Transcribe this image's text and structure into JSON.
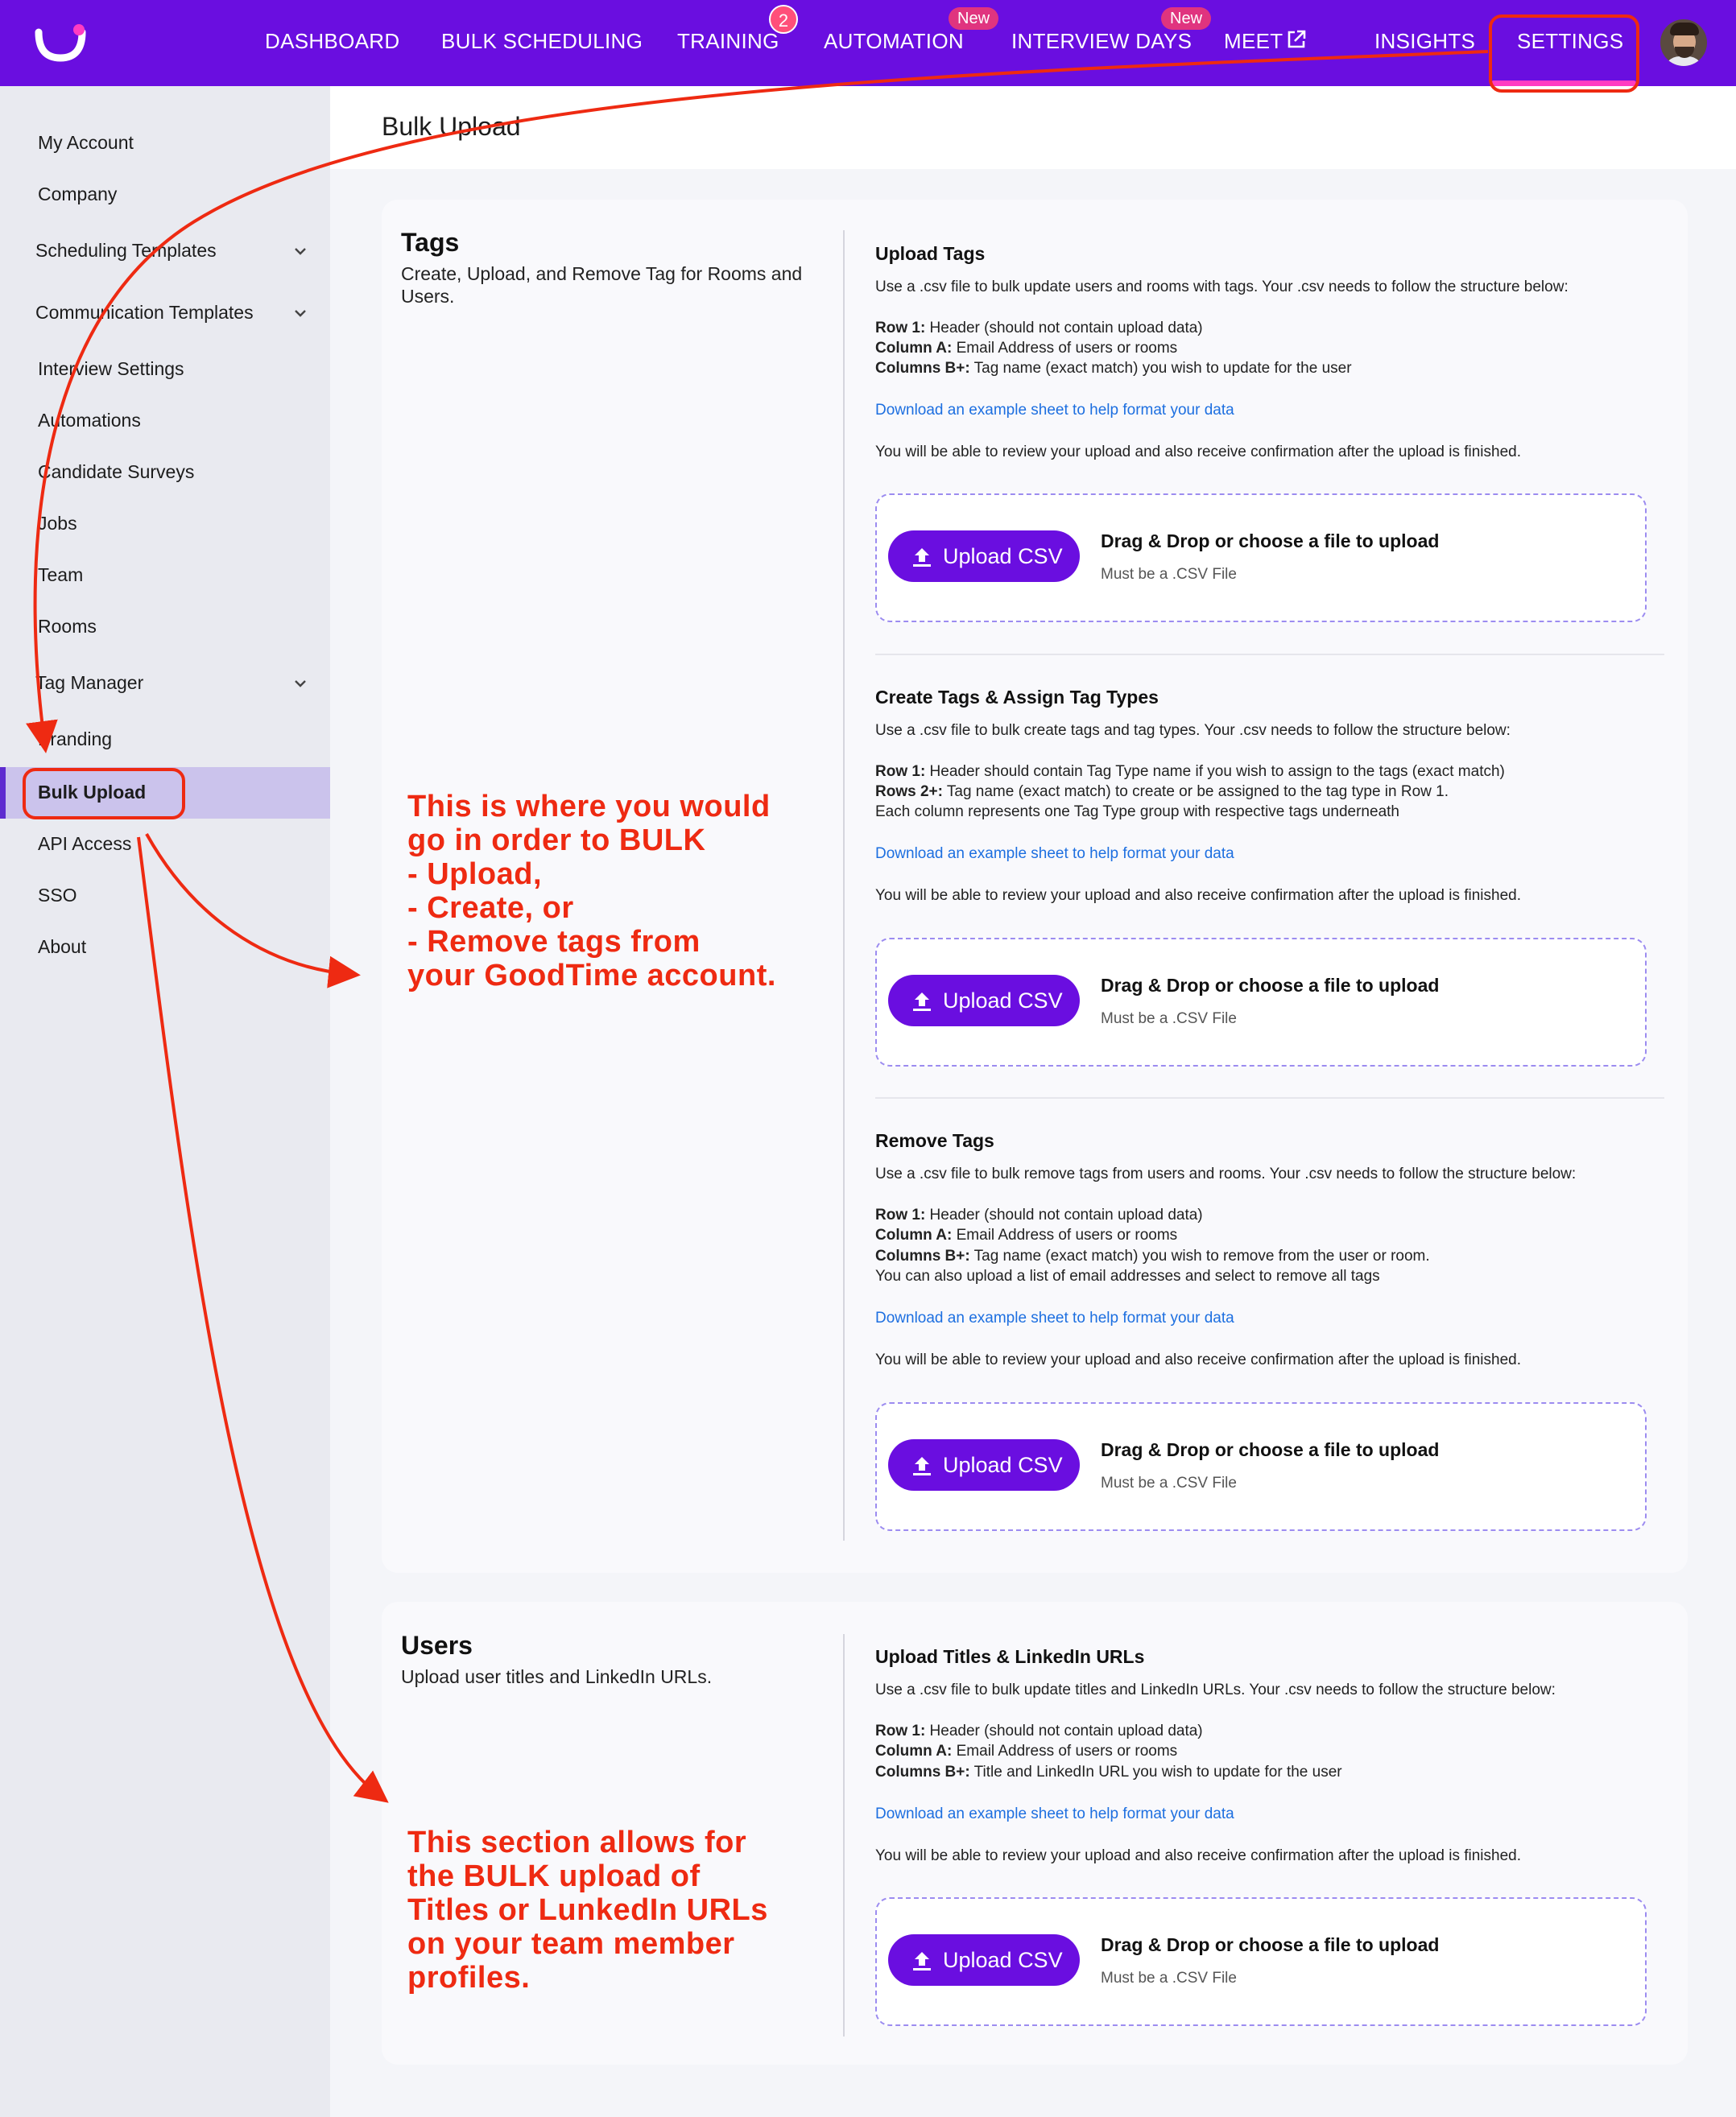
{
  "nav": {
    "items": [
      {
        "label": "DASHBOARD"
      },
      {
        "label": "BULK SCHEDULING"
      },
      {
        "label": "TRAINING",
        "badge": "2"
      },
      {
        "label": "AUTOMATION",
        "badge": "New"
      },
      {
        "label": "INTERVIEW DAYS",
        "badge": "New"
      },
      {
        "label": "MEET"
      },
      {
        "label": "INSIGHTS"
      },
      {
        "label": "SETTINGS"
      }
    ],
    "active": "SETTINGS",
    "accent_color": "#6a0ee0"
  },
  "sidebar": {
    "items": [
      {
        "label": "My Account"
      },
      {
        "label": "Company"
      },
      {
        "label": "Scheduling Templates"
      },
      {
        "label": "Communication Templates"
      },
      {
        "label": "Interview Settings"
      },
      {
        "label": "Automations"
      },
      {
        "label": "Candidate Surveys"
      },
      {
        "label": "Jobs"
      },
      {
        "label": "Team"
      },
      {
        "label": "Rooms"
      },
      {
        "label": "Tag Manager"
      },
      {
        "label": "Branding"
      },
      {
        "label": "Bulk Upload"
      },
      {
        "label": "API Access"
      },
      {
        "label": "SSO"
      },
      {
        "label": "About"
      }
    ],
    "active": "Bulk Upload"
  },
  "page": {
    "title": "Bulk Upload"
  },
  "tags_card": {
    "title": "Tags",
    "desc_line1": "Create, Upload, and Remove Tag for Rooms and",
    "desc_line2": "Users.",
    "sections": [
      {
        "title": "Upload Tags",
        "intro": "Use a .csv file to bulk update users and rooms with tags. Your .csv needs to follow the structure below:",
        "rows": [
          {
            "key": "Row 1:",
            "text": " Header (should not contain upload data)"
          },
          {
            "key": "Column A:",
            "text": " Email Address of users or rooms"
          },
          {
            "key": "Columns B+:",
            "text": " Tag name (exact match) you wish to update for the user"
          }
        ],
        "link": "Download an example sheet to help format your data",
        "note": "You will be able to review your upload and also receive confirmation after the upload is finished."
      },
      {
        "title": "Create Tags & Assign Tag Types",
        "intro": "Use a .csv file to bulk create tags and tag types. Your .csv needs to follow the structure below:",
        "rows": [
          {
            "key": "Row 1:",
            "text": " Header should contain Tag Type name if you wish to assign to the tags (exact match)"
          },
          {
            "key": "Rows 2+:",
            "text": " Tag name (exact match) to create or be assigned to the tag type in Row 1."
          },
          {
            "key": "",
            "text": "Each column represents one Tag Type group with respective tags underneath"
          }
        ],
        "link": "Download an example sheet to help format your data",
        "note": "You will be able to review your upload and also receive confirmation after the upload is finished."
      },
      {
        "title": "Remove Tags",
        "intro": "Use a .csv file to bulk remove tags from users and rooms. Your .csv needs to follow the structure below:",
        "rows": [
          {
            "key": "Row 1:",
            "text": " Header (should not contain upload data)"
          },
          {
            "key": "Column A:",
            "text": " Email Address of users or rooms"
          },
          {
            "key": "Columns B+:",
            "text": " Tag name (exact match) you wish to remove from the user or room."
          },
          {
            "key": "",
            "text": "You can also upload a list of email addresses and select to remove all tags"
          }
        ],
        "link": "Download an example sheet to help format your data",
        "note": "You will be able to review your upload and also receive confirmation after the upload is finished."
      }
    ]
  },
  "users_card": {
    "title": "Users",
    "desc": "Upload user titles and LinkedIn URLs.",
    "section": {
      "title": "Upload Titles & LinkedIn URLs",
      "intro": "Use a .csv file to bulk update titles and LinkedIn URLs. Your .csv needs to follow the structure below:",
      "rows": [
        {
          "key": "Row 1:",
          "text": " Header (should not contain upload data)"
        },
        {
          "key": "Column A:",
          "text": " Email Address of users or rooms"
        },
        {
          "key": "Columns B+:",
          "text": " Title and LinkedIn URL you wish to update for the user"
        }
      ],
      "link": "Download an example sheet to help format your data",
      "note": "You will be able to review your upload and also receive confirmation after the upload is finished."
    }
  },
  "dropzone": {
    "button": "Upload CSV",
    "title": "Drag & Drop or choose a file to upload",
    "sub": "Must be a .CSV File"
  },
  "annotations": {
    "tags_note": [
      "This is where you would",
      "go in order to BULK",
      "- Upload,",
      "- Create, or",
      "- Remove tags from",
      "your GoodTime account."
    ],
    "users_note": [
      "This section allows for",
      "the BULK upload of",
      "Titles or LunkedIn URLs",
      "on your team member",
      "profiles."
    ],
    "color": "#ee2a12"
  }
}
